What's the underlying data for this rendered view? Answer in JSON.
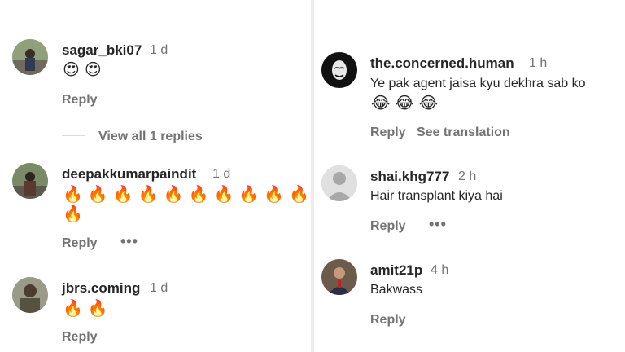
{
  "left_comments": [
    {
      "username": "sagar_bki07",
      "time": "1 d",
      "emojis": [
        "😍",
        "😍"
      ],
      "reply_label": "Reply",
      "view_replies_label": "View all 1 replies"
    },
    {
      "username": "deepakkumarpaindit",
      "time": "1 d",
      "emojis_line1": [
        "🔥",
        "🔥",
        "🔥",
        "🔥",
        "🔥",
        "🔥",
        "🔥",
        "🔥",
        "🔥",
        "🔥",
        "🔥"
      ],
      "emojis_line2": [
        "🔥"
      ],
      "reply_label": "Reply",
      "more_label": "•••"
    },
    {
      "username": "jbrs.coming",
      "time": "1 d",
      "emojis": [
        "🔥",
        "🔥"
      ],
      "reply_label": "Reply"
    }
  ],
  "right_comments": [
    {
      "username": "the.concerned.human",
      "time": "1 h",
      "text": "Ye pak agent jaisa kyu dekhra sab ko",
      "emojis": [
        "😂",
        "😂",
        "😂"
      ],
      "reply_label": "Reply",
      "translate_label": "See translation"
    },
    {
      "username": "shai.khg777",
      "time": "2 h",
      "text": "Hair transplant kiya hai",
      "reply_label": "Reply",
      "more_label": "•••"
    },
    {
      "username": "amit21p",
      "time": "4 h",
      "text": "Bakwass",
      "reply_label": "Reply"
    }
  ]
}
